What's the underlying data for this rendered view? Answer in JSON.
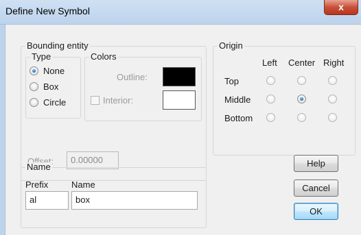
{
  "window": {
    "title": "Define New Symbol",
    "close_glyph": "x"
  },
  "bounding": {
    "title": "Bounding entity",
    "type": {
      "title": "Type",
      "options": [
        {
          "label": "None",
          "checked": true
        },
        {
          "label": "Box",
          "checked": false
        },
        {
          "label": "Circle",
          "checked": false
        }
      ]
    },
    "colors": {
      "title": "Colors",
      "outline_label": "Outline:",
      "outline_color": "#000000",
      "interior_label": "Interior:",
      "interior_color": "#ffffff",
      "interior_checked": false
    },
    "offset_label": "Offset:",
    "offset_value": "0.00000"
  },
  "origin": {
    "title": "Origin",
    "columns": [
      "Left",
      "Center",
      "Right"
    ],
    "rows": [
      "Top",
      "Middle",
      "Bottom"
    ],
    "selected": "Middle-Center"
  },
  "name_group": {
    "title": "Name",
    "prefix_label": "Prefix",
    "prefix_value": "al",
    "name_label": "Name",
    "name_value": "box"
  },
  "buttons": {
    "help": "Help",
    "cancel": "Cancel",
    "ok": "OK"
  }
}
